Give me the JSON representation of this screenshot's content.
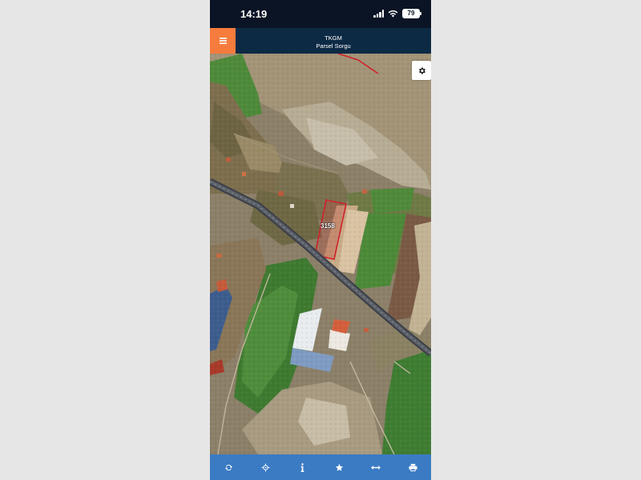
{
  "status_bar": {
    "time": "14:19",
    "battery": "79"
  },
  "app_bar": {
    "title": "TKGM",
    "subtitle": "Parsel Sorgu",
    "menu_icon": "hamburger-menu-icon"
  },
  "map": {
    "parcel_label": "3158",
    "settings_icon": "gear-icon"
  },
  "toolbar": {
    "buttons": [
      {
        "icon": "refresh-icon"
      },
      {
        "icon": "locate-icon"
      },
      {
        "icon": "info-icon"
      },
      {
        "icon": "star-icon"
      },
      {
        "icon": "measure-icon"
      },
      {
        "icon": "print-icon"
      }
    ]
  },
  "colors": {
    "menu_accent": "#f57c3c",
    "appbar_bg": "#0d2a45",
    "toolbar_bg": "#3a7bc3",
    "parcel_outline": "#d0202a"
  }
}
